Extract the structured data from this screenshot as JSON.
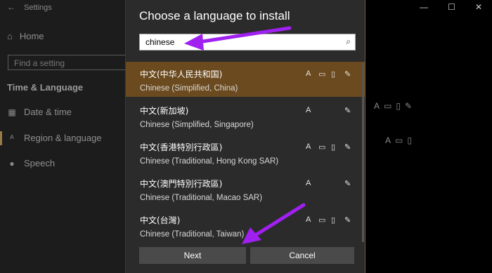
{
  "background": {
    "title": "Settings",
    "back_glyph": "←",
    "home_label": "Home",
    "search_placeholder": "Find a setting",
    "section_title": "Time & Language",
    "nav": [
      {
        "label": "Date & time",
        "icon": "calendar-icon"
      },
      {
        "label": "Region & language",
        "icon": "language-icon"
      },
      {
        "label": "Speech",
        "icon": "microphone-icon"
      }
    ],
    "window_controls": {
      "minimize": "—",
      "maximize": "☐",
      "close": "✕"
    }
  },
  "dialog": {
    "title": "Choose a language to install",
    "search": {
      "value": "chinese"
    },
    "languages": [
      {
        "native": "中文(中华人民共和国)",
        "name": "Chinese (Simplified, China)",
        "selected": true,
        "features": [
          "display",
          "text-to-speech",
          "speech",
          "handwriting"
        ]
      },
      {
        "native": "中文(新加坡)",
        "name": "Chinese (Simplified, Singapore)",
        "selected": false,
        "features": [
          "display",
          "handwriting"
        ]
      },
      {
        "native": "中文(香港特別行政區)",
        "name": "Chinese (Traditional, Hong Kong SAR)",
        "selected": false,
        "features": [
          "display",
          "text-to-speech",
          "speech",
          "handwriting"
        ]
      },
      {
        "native": "中文(澳門特別行政區)",
        "name": "Chinese (Traditional, Macao SAR)",
        "selected": false,
        "features": [
          "display",
          "handwriting"
        ]
      },
      {
        "native": "中文(台灣)",
        "name": "Chinese (Traditional, Taiwan)",
        "selected": false,
        "features": [
          "display",
          "text-to-speech",
          "speech",
          "handwriting"
        ]
      }
    ],
    "buttons": {
      "next": "Next",
      "cancel": "Cancel"
    }
  },
  "annotation_color": "#a020f0",
  "accent_color": "#6b4a1f"
}
